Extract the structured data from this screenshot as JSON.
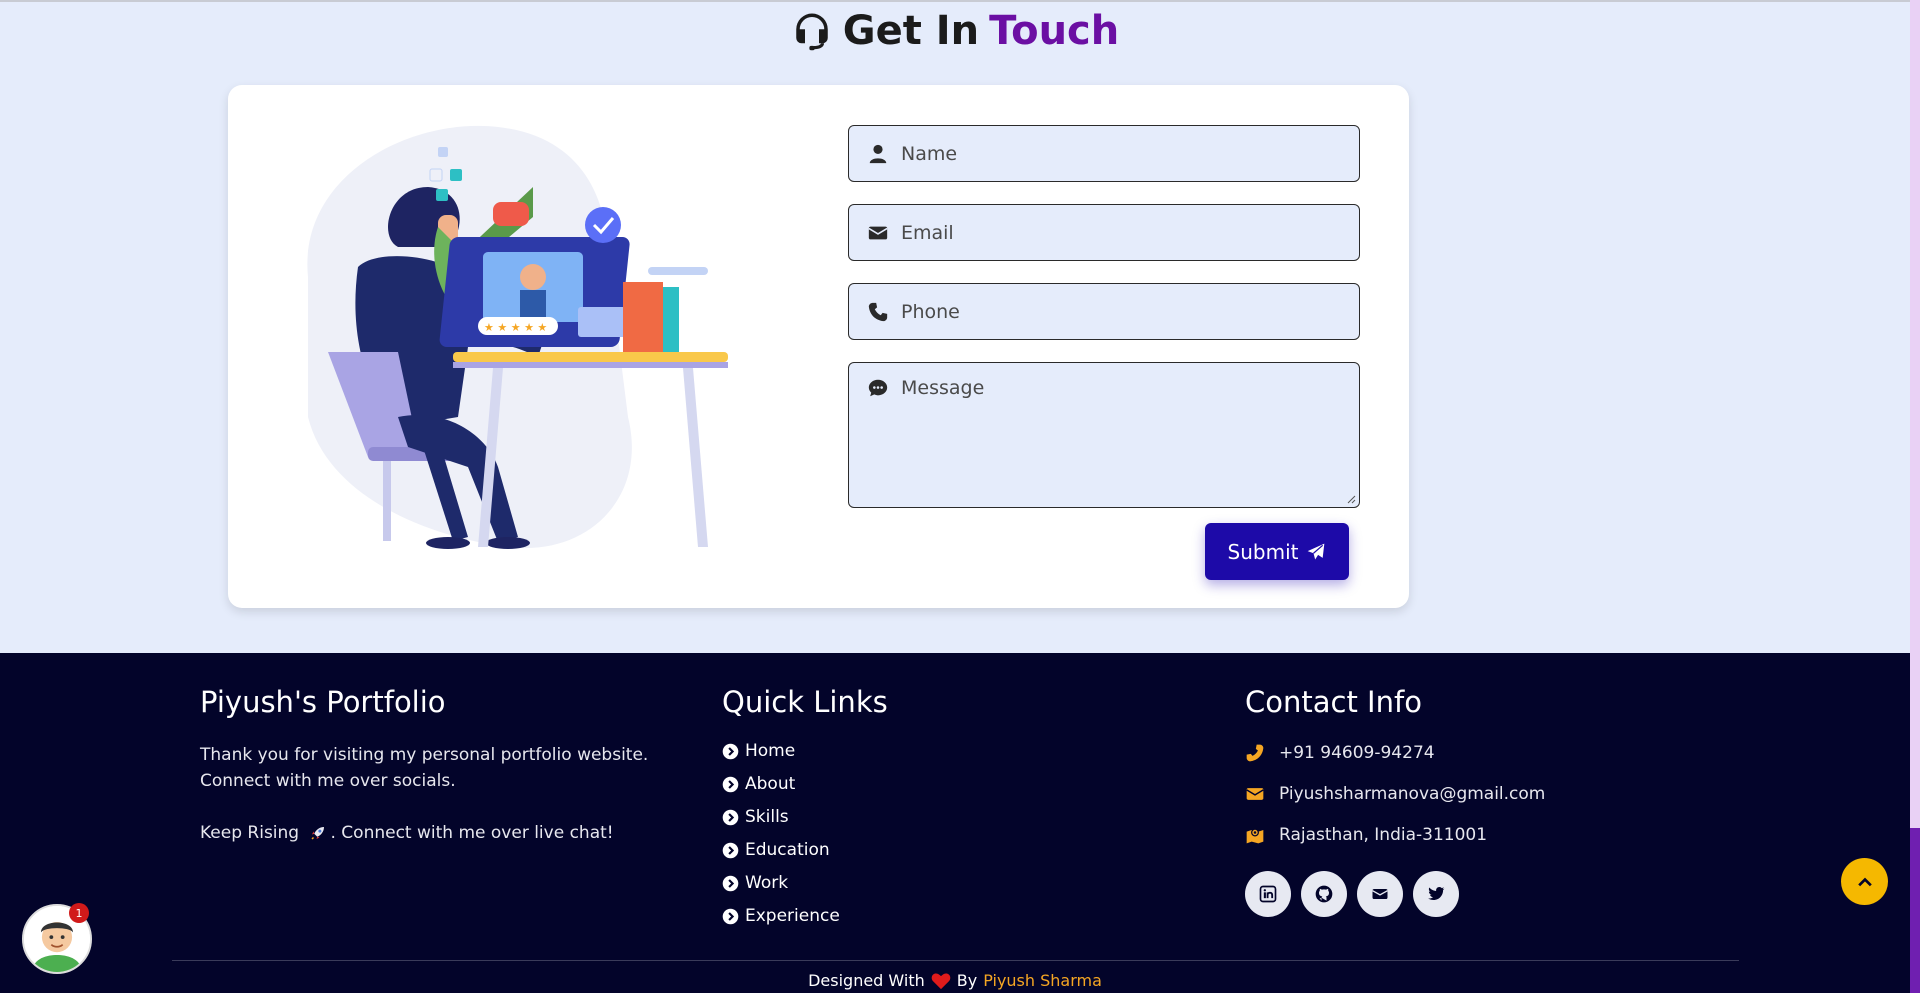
{
  "contact": {
    "heading_part1": "Get In",
    "heading_part2": "Touch",
    "form": {
      "name_placeholder": "Name",
      "email_placeholder": "Email",
      "phone_placeholder": "Phone",
      "message_placeholder": "Message",
      "submit_label": "Submit"
    }
  },
  "footer": {
    "about": {
      "title": "Piyush's Portfolio",
      "text1": "Thank you for visiting my personal portfolio website.",
      "text2": "Connect with me over socials.",
      "text3_before": "Keep Rising ",
      "text3_after": ". Connect with me over live chat!"
    },
    "quick_links": {
      "title": "Quick Links",
      "items": [
        "Home",
        "About",
        "Skills",
        "Education",
        "Work",
        "Experience"
      ]
    },
    "contact_info": {
      "title": "Contact Info",
      "phone": "+91 94609-94274",
      "email": "Piyushsharmanova@gmail.com",
      "address": "Rajasthan, India-311001"
    },
    "socials": [
      "linkedin-icon",
      "github-icon",
      "envelope-icon",
      "twitter-icon"
    ],
    "credit_before": "Designed With",
    "credit_by": "By",
    "credit_author": "Piyush Sharma"
  },
  "chat": {
    "badge_count": "1"
  },
  "colors": {
    "accent": "#6b0fa3",
    "submit": "#1d0aa8",
    "footer_bg": "#03042a",
    "icon_yellow": "#f5a623"
  }
}
